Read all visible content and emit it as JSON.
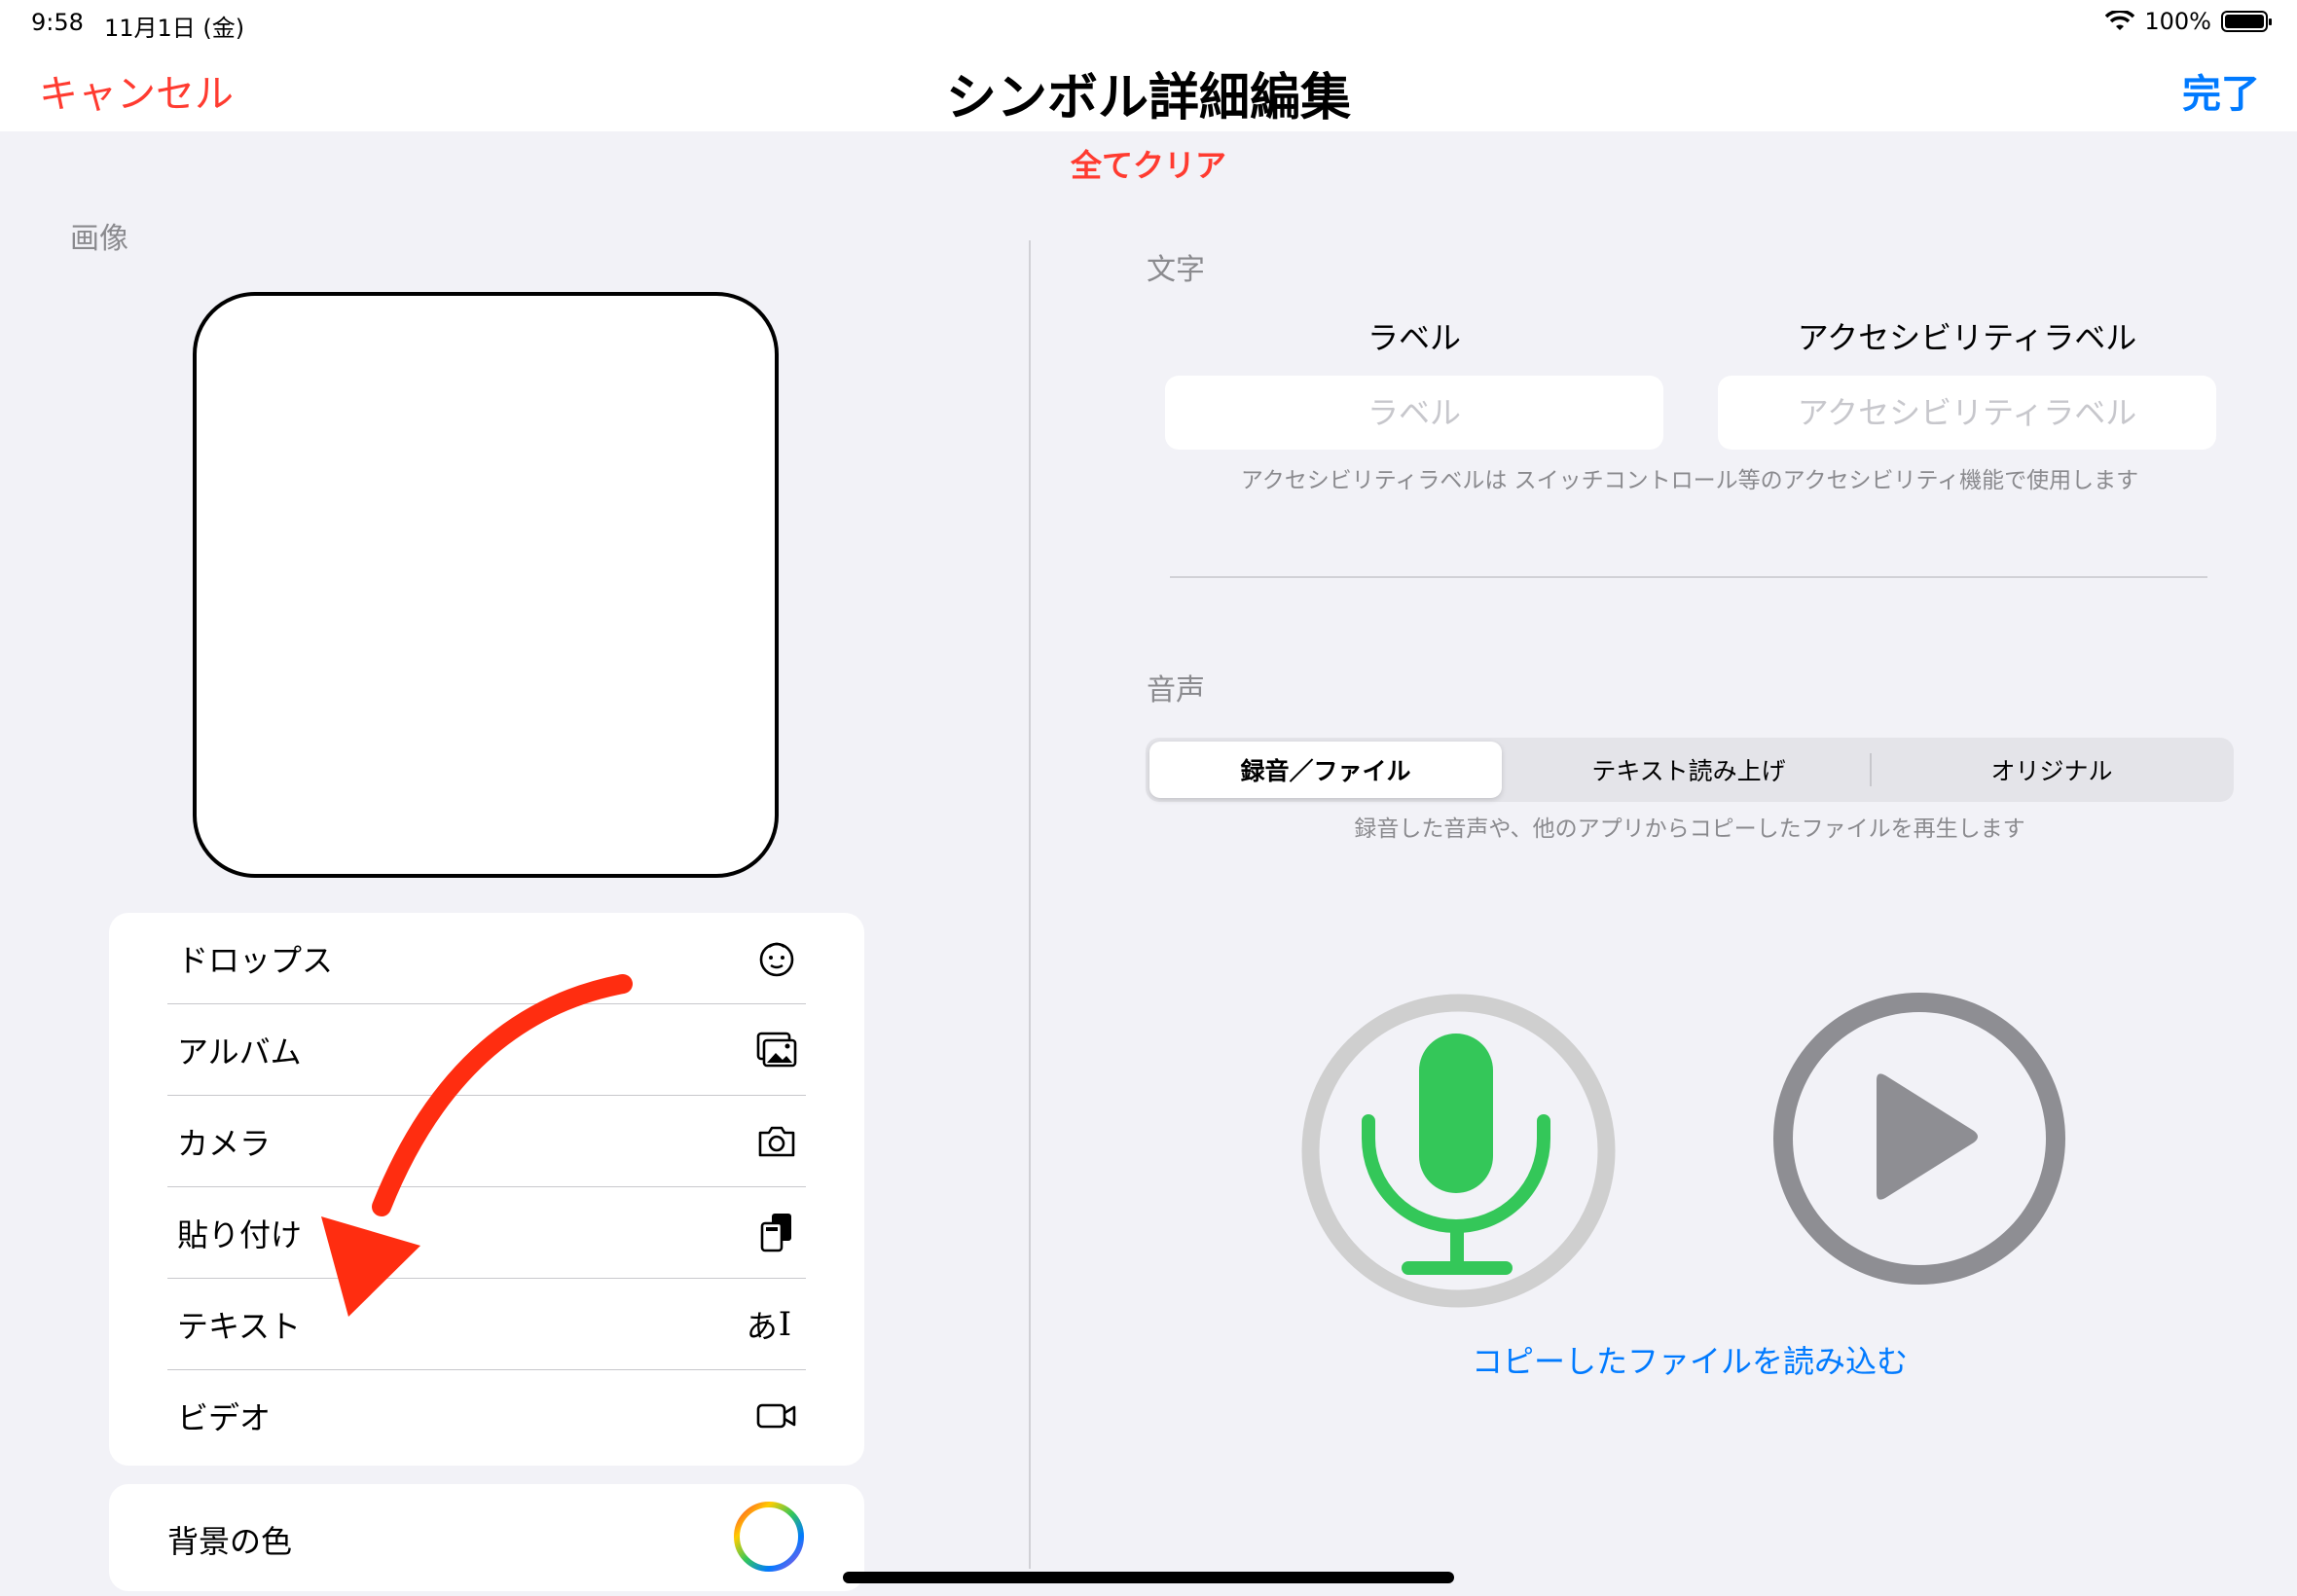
{
  "status_bar": {
    "time": "9:58",
    "date": "11月1日 (金)",
    "battery": "100%"
  },
  "nav": {
    "cancel": "キャンセル",
    "title": "シンボル詳細編集",
    "done": "完了",
    "clear_all": "全てクリア"
  },
  "image_section": {
    "label": "画像",
    "sources": [
      {
        "label": "ドロップス",
        "icon": "face-icon"
      },
      {
        "label": "アルバム",
        "icon": "photo-album-icon"
      },
      {
        "label": "カメラ",
        "icon": "camera-icon"
      },
      {
        "label": "貼り付け",
        "icon": "paste-icon"
      },
      {
        "label": "テキスト",
        "icon": "text-input-icon"
      },
      {
        "label": "ビデオ",
        "icon": "video-icon"
      }
    ],
    "text_icon_glyph": "あ",
    "background_color_label": "背景の色"
  },
  "text_section": {
    "label": "文字",
    "label_header": "ラベル",
    "label_placeholder": "ラベル",
    "accessibility_header": "アクセシビリティラベル",
    "accessibility_placeholder": "アクセシビリティラベル",
    "caption": "アクセシビリティラベルは スイッチコントロール等のアクセシビリティ機能で使用します"
  },
  "audio_section": {
    "label": "音声",
    "segments": [
      "録音／ファイル",
      "テキスト読み上げ",
      "オリジナル"
    ],
    "selected_segment": "録音／ファイル",
    "caption": "録音した音声や、他のアプリからコピーしたファイルを再生します",
    "load_link": "コピーしたファイルを読み込む"
  },
  "colors": {
    "accent_blue": "#007aff",
    "destructive_red": "#ff3b30",
    "mic_green": "#34c759",
    "annotation_arrow": "#ff2d10"
  }
}
